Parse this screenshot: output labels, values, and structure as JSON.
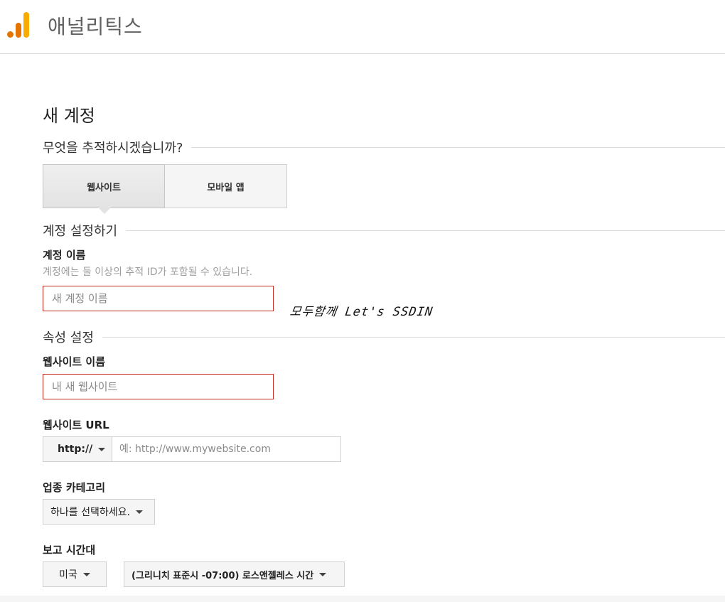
{
  "header": {
    "app_title": "애널리틱스",
    "colors": {
      "logo_orange": "#e37400",
      "logo_yellow": "#f9ab00"
    }
  },
  "page": {
    "title": "새 계정"
  },
  "tracking": {
    "question": "무엇을 추적하시겠습니까?",
    "options": [
      {
        "label": "웹사이트",
        "selected": true
      },
      {
        "label": "모바일 앱",
        "selected": false
      }
    ]
  },
  "account_setup": {
    "heading": "계정 설정하기",
    "name_label": "계정 이름",
    "name_hint": "계정에는 둘 이상의 추적 ID가 포함될 수 있습니다.",
    "name_placeholder": "새 계정 이름",
    "name_value": ""
  },
  "watermark": "모두함께 Let's SSDIN",
  "property_setup": {
    "heading": "속성 설정",
    "website_name_label": "웹사이트 이름",
    "website_name_placeholder": "내 새 웹사이트",
    "website_name_value": "",
    "url_label": "웹사이트 URL",
    "protocol_selected": "http://",
    "url_placeholder": "예: http://www.mywebsite.com",
    "url_value": "",
    "category_label": "업종 카테고리",
    "category_selected": "하나를 선택하세요.",
    "timezone_label": "보고 시간대",
    "country_selected": "미국",
    "timezone_selected": "(그리니치 표준시 -07:00) 로스앤젤레스 시간"
  },
  "colors": {
    "error_border": "#c5281c",
    "divider": "#dcdcdc"
  },
  "icons": {
    "dropdown": "caret-down-icon",
    "logo": "analytics-logo-icon"
  }
}
